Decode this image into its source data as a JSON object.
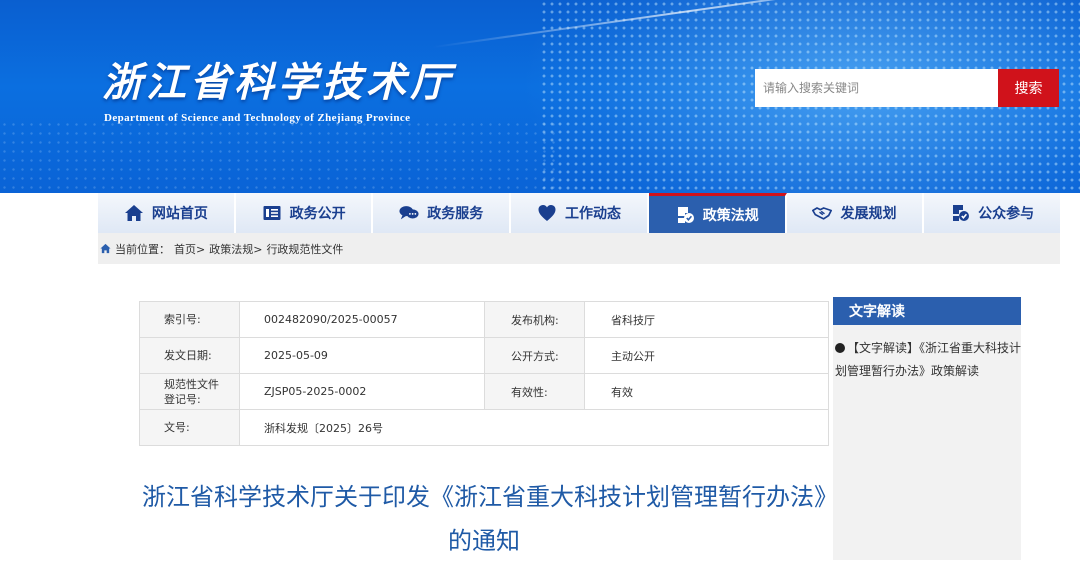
{
  "header": {
    "site_title": "浙江省科学技术厅",
    "site_subtitle": "Department of Science and Technology of Zhejiang Province",
    "search_placeholder": "请输入搜索关键词",
    "search_button": "搜索"
  },
  "nav": {
    "items": [
      {
        "label": "网站首页",
        "icon": "home-icon"
      },
      {
        "label": "政务公开",
        "icon": "document-list-icon"
      },
      {
        "label": "政务服务",
        "icon": "chat-bubbles-icon"
      },
      {
        "label": "工作动态",
        "icon": "heart-icon"
      },
      {
        "label": "政策法规",
        "icon": "policy-icon",
        "active": true
      },
      {
        "label": "发展规划",
        "icon": "handshake-icon"
      },
      {
        "label": "公众参与",
        "icon": "participation-icon"
      }
    ]
  },
  "breadcrumb": {
    "prefix": "当前位置：",
    "items": [
      "首页>",
      "政策法规>",
      "行政规范性文件"
    ]
  },
  "info": {
    "rows": [
      {
        "k1": "索引号:",
        "v1": "002482090/2025-00057",
        "k2": "发布机构:",
        "v2": "省科技厅"
      },
      {
        "k1": "发文日期:",
        "v1": "2025-05-09",
        "k2": "公开方式:",
        "v2": "主动公开"
      },
      {
        "k1": "规范性文件登记号:",
        "v1": "ZJSP05-2025-0002",
        "k2": "有效性:",
        "v2": "有效"
      },
      {
        "k1": "文号:",
        "v1": "浙科发规〔2025〕26号"
      }
    ]
  },
  "article": {
    "title": "浙江省科学技术厅关于印发《浙江省重大科技计划管理暂行办法》的通知"
  },
  "sidebar": {
    "heading": "文字解读",
    "link": "【文字解读】《浙江省重大科技计划管理暂行办法》政策解读"
  },
  "colors": {
    "banner_blue": "#0b6fe0",
    "nav_active": "#2b5fae",
    "search_red": "#d0121b",
    "title_blue": "#1f5aa6"
  }
}
